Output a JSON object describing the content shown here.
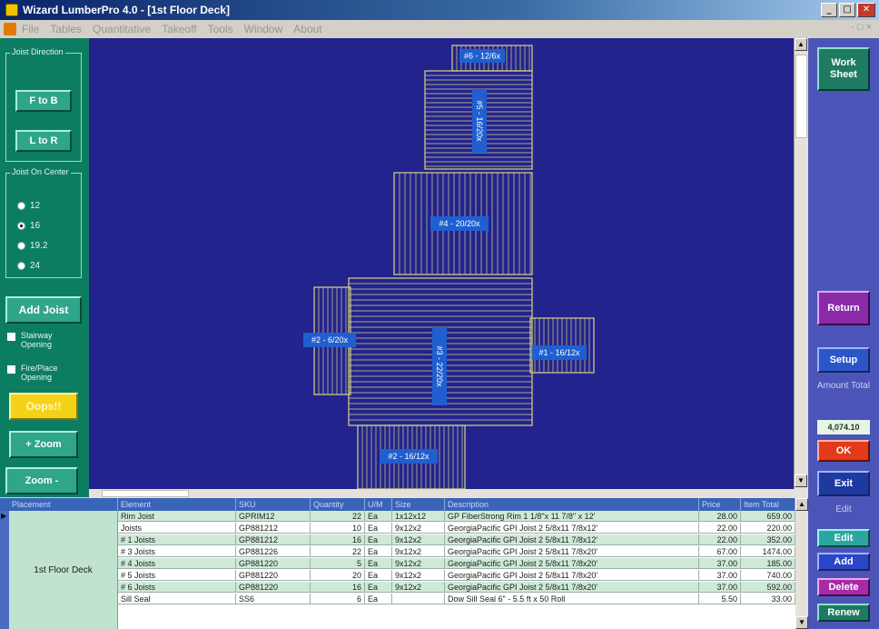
{
  "window": {
    "title": "Wizard LumberPro 4.0 - [1st Floor Deck]"
  },
  "menu": {
    "items": [
      "File",
      "Tables",
      "Quantitative",
      "Takeoff",
      "Tools",
      "Window",
      "About"
    ],
    "right": "- □ ×"
  },
  "left_panel": {
    "joist_direction": {
      "title": "Joist Direction",
      "btn_fb": "F to B",
      "btn_lr": "L to R"
    },
    "joist_oc": {
      "title": "Joist On Center",
      "options": [
        "12",
        "16",
        "19.2",
        "24"
      ],
      "selected": "16"
    },
    "add_joist": "Add Joist",
    "stairway_opening": "Stairway Opening",
    "fireplace_opening": "Fire/Place Opening",
    "oops": "Oops!!",
    "zoom_in": "+ Zoom",
    "zoom_out": "Zoom -"
  },
  "canvas": {
    "background": "#23238e",
    "line_color": "#d8d480",
    "label_color": "#1f5fd0",
    "labels": [
      "#6 - 12/6x",
      "#5 - 16/20x",
      "#4 - 20/20x",
      "#2 - 6/20x",
      "#3 - 22/20x",
      "#1 - 16/12x",
      "#2 - 16/12x"
    ]
  },
  "right_panel": {
    "worksheet": "Work Sheet",
    "return": "Return",
    "setup": "Setup",
    "amount_label": "Amount Total",
    "amount_total": "4,074.10",
    "ok": "OK",
    "exit": "Exit",
    "edit_label": "Edit",
    "edit": "Edit",
    "add": "Add",
    "delete": "Delete",
    "renew": "Renew"
  },
  "table": {
    "columns": [
      "Placement",
      "Element",
      "SKU",
      "Quantity",
      "U/M",
      "Size",
      "Description",
      "Price",
      "Item Total"
    ],
    "group": "1st Floor Deck",
    "rows": [
      {
        "element": "Rim Joist",
        "sku": "GPRIM12",
        "qty": "22",
        "um": "Ea",
        "size": "1x12x12",
        "desc": "GP FiberStrong Rim 1 1/8\"x 11 7/8\" x 12'",
        "price": "28.00",
        "total": "659.00"
      },
      {
        "element": "Joists",
        "sku": "GP881212",
        "qty": "10",
        "um": "Ea",
        "size": "9x12x2",
        "desc": "GeorgiaPacific GPI Joist 2 5/8x11 7/8x12'",
        "price": "22.00",
        "total": "220.00"
      },
      {
        "element": "# 1 Joists",
        "sku": "GP881212",
        "qty": "16",
        "um": "Ea",
        "size": "9x12x2",
        "desc": "GeorgiaPacific GPI Joist 2 5/8x11 7/8x12'",
        "price": "22.00",
        "total": "352.00"
      },
      {
        "element": "# 3 Joists",
        "sku": "GP881226",
        "qty": "22",
        "um": "Ea",
        "size": "9x12x2",
        "desc": "GeorgiaPacific GPI Joist 2 5/8x11 7/8x20'",
        "price": "67.00",
        "total": "1474.00"
      },
      {
        "element": "# 4 Joists",
        "sku": "GP881220",
        "qty": "5",
        "um": "Ea",
        "size": "9x12x2",
        "desc": "GeorgiaPacific GPI Joist 2 5/8x11 7/8x20'",
        "price": "37.00",
        "total": "185.00"
      },
      {
        "element": "# 5 Joists",
        "sku": "GP881220",
        "qty": "20",
        "um": "Ea",
        "size": "9x12x2",
        "desc": "GeorgiaPacific GPI Joist 2 5/8x11 7/8x20'",
        "price": "37.00",
        "total": "740.00"
      },
      {
        "element": "# 6 Joists",
        "sku": "GP881220",
        "qty": "16",
        "um": "Ea",
        "size": "9x12x2",
        "desc": "GeorgiaPacific GPI Joist 2 5/8x11 7/8x20'",
        "price": "37.00",
        "total": "592.00"
      },
      {
        "element": "Sill Seal",
        "sku": "SS6",
        "qty": "6",
        "um": "Ea",
        "size": "",
        "desc": "Dow Sill Seal 6\" - 5.5 ft x 50 Roll",
        "price": "5.50",
        "total": "33.00"
      }
    ]
  }
}
